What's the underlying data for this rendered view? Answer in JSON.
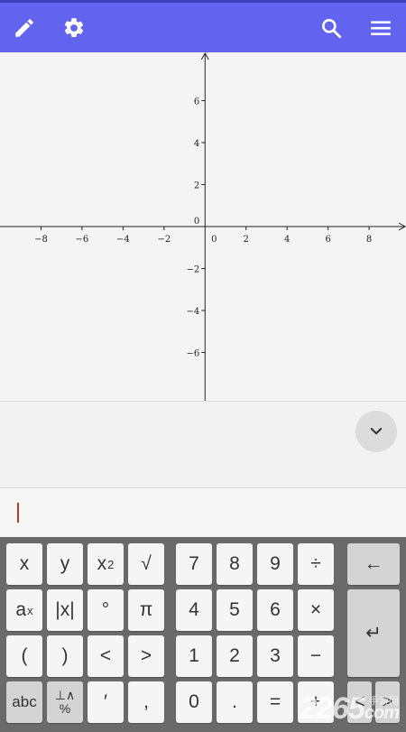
{
  "toolbar": {
    "accent": "#6264f0",
    "icons": [
      "pencil-icon",
      "gear-icon",
      "search-icon",
      "menu-icon"
    ]
  },
  "graph": {
    "x_min": -10,
    "x_max": 9.8,
    "y_min": -8.3,
    "y_max": 8.3,
    "x_ticks": [
      -8,
      -6,
      -4,
      -2,
      2,
      4,
      6,
      8
    ],
    "y_ticks": [
      6,
      4,
      2,
      -2,
      -4,
      -6
    ],
    "x_tick_labels": [
      "−8",
      "−6",
      "−4",
      "−2",
      "2",
      "4",
      "6",
      "8"
    ],
    "y_tick_labels": [
      "6",
      "4",
      "2",
      "−2",
      "−4",
      "−6"
    ],
    "origin_labels": [
      "0",
      "0"
    ]
  },
  "keyboard": {
    "rows": [
      [
        "x",
        "y",
        "x2",
        "√",
        "7",
        "8",
        "9",
        "÷",
        "←"
      ],
      [
        "ax",
        "|x|",
        "°",
        "π",
        "4",
        "5",
        "6",
        "×",
        "↵"
      ],
      [
        "(",
        ")",
        "<",
        ">",
        "1",
        "2",
        "3",
        "−"
      ],
      [
        "abc",
        "⊥∧ %",
        "′",
        ",",
        "0",
        ".",
        "=",
        "+",
        "<",
        ">"
      ]
    ],
    "labels": {
      "x": "x",
      "y": "y",
      "x2_base": "x",
      "x2_exp": "2",
      "sqrt": "√",
      "n7": "7",
      "n8": "8",
      "n9": "9",
      "div": "÷",
      "backspace": "←",
      "ax_base": "a",
      "ax_exp": "x",
      "abs": "|x|",
      "deg": "°",
      "pi": "π",
      "n4": "4",
      "n5": "5",
      "n6": "6",
      "mul": "×",
      "enter": "↵",
      "lparen": "(",
      "rparen": ")",
      "lt": "<",
      "gt": ">",
      "n1": "1",
      "n2": "2",
      "n3": "3",
      "minus": "−",
      "abc": "abc",
      "sym_top": "⊥∧",
      "sym_bottom": "%",
      "prime": "′",
      "comma": ",",
      "n0": "0",
      "dot": ".",
      "eq": "=",
      "plus": "+",
      "left": "<",
      "right": ">"
    }
  },
  "watermark": {
    "text": "2265",
    "sub": "手游网",
    "suffix": "com"
  }
}
